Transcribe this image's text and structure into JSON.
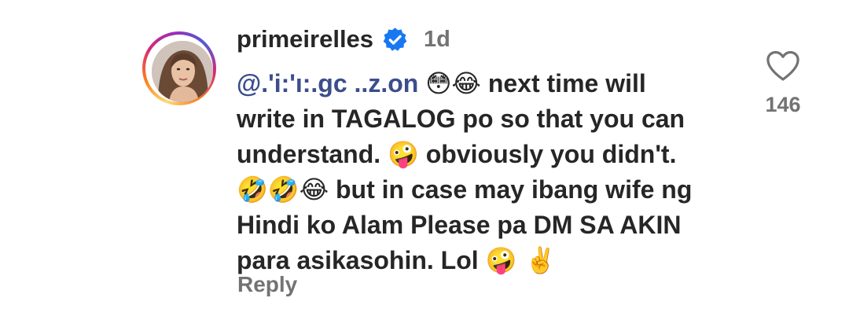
{
  "comment": {
    "username": "primeirelles",
    "verified": true,
    "timestamp": "1d",
    "mention": "@.'i:'ı:.gc ..z.on",
    "lines": [
      {
        "before": "",
        "emoji": "😳😂",
        "after": " next time will"
      },
      {
        "text": "write in TAGALOG po so that you can"
      },
      {
        "before": "understand. ",
        "emoji": "🤪",
        "after": " obviously you didn't."
      },
      {
        "emoji": "🤣🤣😂",
        "after": " but in case may ibang wife ng"
      },
      {
        "text": "Hindi ko Alam Please pa DM SA AKIN"
      },
      {
        "before": "para asikasohin. Lol ",
        "emoji": "🤪 ✌️",
        "after": ""
      }
    ],
    "reply_label": "Reply",
    "like_count": "146"
  },
  "icons": {
    "verified": "verified-badge-icon",
    "like": "heart-outline-icon",
    "verified_color": "#1877f2"
  }
}
